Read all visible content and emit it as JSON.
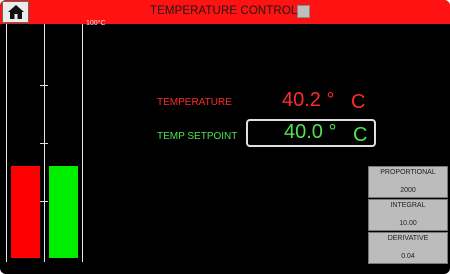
{
  "header": {
    "title": "TEMPERATURE CONTROL",
    "home_icon": "home-icon"
  },
  "gauge": {
    "max_label": "100°C",
    "temperature_level": 0.4,
    "setpoint_level": 0.4,
    "colors": {
      "temperature": "#ff0000",
      "setpoint": "#00ee00"
    }
  },
  "readouts": {
    "temperature_label": "TEMPERATURE",
    "temperature_value": "40.2 °",
    "temperature_unit": "C",
    "setpoint_label": "TEMP SETPOINT",
    "setpoint_value": "40.0 °",
    "setpoint_unit": "C"
  },
  "pid": [
    {
      "name": "PROPORTIONAL",
      "value": "2000"
    },
    {
      "name": "INTEGRAL",
      "value": "10.00"
    },
    {
      "name": "DERIVATIVE",
      "value": "0.04"
    }
  ]
}
